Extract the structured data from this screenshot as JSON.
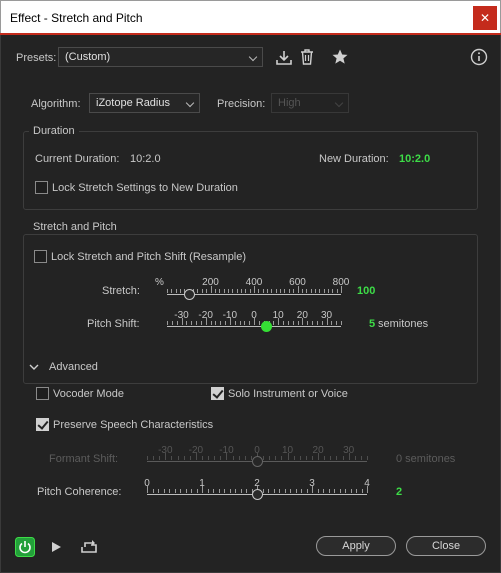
{
  "window": {
    "title": "Effect - Stretch and Pitch",
    "close_glyph": "✕"
  },
  "presets": {
    "label": "Presets:",
    "value": "(Custom)"
  },
  "algorithm": {
    "label": "Algorithm:",
    "value": "iZotope Radius"
  },
  "precision": {
    "label": "Precision:",
    "value": "High"
  },
  "duration": {
    "title": "Duration",
    "current_label": "Current Duration:",
    "current_value": "10:2.0",
    "new_label": "New Duration:",
    "new_value": "10:2.0",
    "lock_label": "Lock Stretch Settings to New Duration",
    "lock_checked": false
  },
  "stretch_pitch": {
    "title": "Stretch and Pitch",
    "lock_label": "Lock Stretch and Pitch Shift (Resample)",
    "lock_checked": false,
    "stretch": {
      "label": "Stretch:",
      "unit": "%",
      "ticks": [
        "200",
        "400",
        "600",
        "800"
      ],
      "value": "100",
      "min": 0,
      "max": 800
    },
    "pitch": {
      "label": "Pitch Shift:",
      "ticks": [
        "-30",
        "-20",
        "-10",
        "0",
        "10",
        "20",
        "30"
      ],
      "value": "5",
      "unit": "semitones",
      "min": -36,
      "max": 36
    }
  },
  "advanced": {
    "title": "Advanced",
    "vocoder_label": "Vocoder Mode",
    "vocoder_checked": false,
    "solo_label": "Solo Instrument or Voice",
    "solo_checked": true,
    "preserve_label": "Preserve Speech Characteristics",
    "preserve_checked": true,
    "formant": {
      "label": "Formant Shift:",
      "ticks": [
        "-30",
        "-20",
        "-10",
        "0",
        "10",
        "20",
        "30"
      ],
      "value": "0 semitones",
      "min": -36,
      "max": 36,
      "current": 0
    },
    "coherence": {
      "label": "Pitch Coherence:",
      "ticks": [
        "0",
        "1",
        "2",
        "3",
        "4"
      ],
      "value": "2",
      "min": 0,
      "max": 4
    }
  },
  "footer": {
    "apply_label": "Apply",
    "close_label": "Close"
  },
  "colors": {
    "accent_green": "#3ddc47",
    "close_red": "#c42b1c"
  }
}
